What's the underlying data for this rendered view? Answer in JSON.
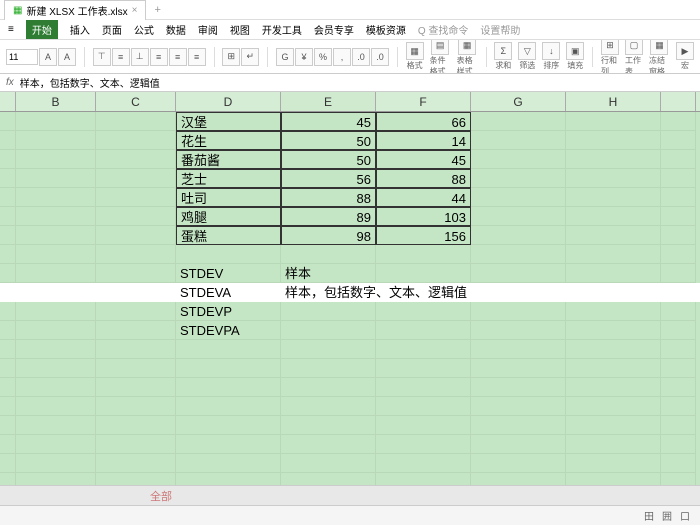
{
  "title": "新建 XLSX 工作表.xlsx",
  "menus": [
    "开始",
    "插入",
    "页面",
    "公式",
    "数据",
    "审阅",
    "视图",
    "开发工具",
    "会员专享",
    "模板资源",
    "Q 查找命令",
    "设置帮助"
  ],
  "font_size": "11",
  "formula_text": "样本，包括数字、文本、逻辑值",
  "tb_labels": {
    "format": "格式",
    "cond": "条件格式",
    "table": "表格样式",
    "sum": "求和",
    "filter": "筛选",
    "sort": "排序",
    "fill": "填充",
    "row": "行和列",
    "sheet": "工作表",
    "freeze": "冻结窗格",
    "macro": "宏"
  },
  "columns": [
    "B",
    "C",
    "D",
    "E",
    "F",
    "G",
    "H"
  ],
  "data_rows": [
    {
      "d": "汉堡",
      "e": "45",
      "f": "66"
    },
    {
      "d": "花生",
      "e": "50",
      "f": "14"
    },
    {
      "d": "番茄酱",
      "e": "50",
      "f": "45"
    },
    {
      "d": "芝士",
      "e": "56",
      "f": "88"
    },
    {
      "d": "吐司",
      "e": "88",
      "f": "44"
    },
    {
      "d": "鸡腿",
      "e": "89",
      "f": "103"
    },
    {
      "d": "蛋糕",
      "e": "98",
      "f": "156"
    }
  ],
  "label_rows": [
    {
      "d": "STDEV",
      "e": "样本",
      "hl": false
    },
    {
      "d": "STDEVA",
      "e": "样本，包括数字、文本、逻辑值",
      "hl": true
    },
    {
      "d": "STDEVP",
      "e": "",
      "hl": false
    },
    {
      "d": "STDEVPA",
      "e": "",
      "hl": false
    }
  ],
  "sheet_tab": "全部",
  "status": {
    "view": "田",
    "grid": "囲",
    "page": "口"
  }
}
